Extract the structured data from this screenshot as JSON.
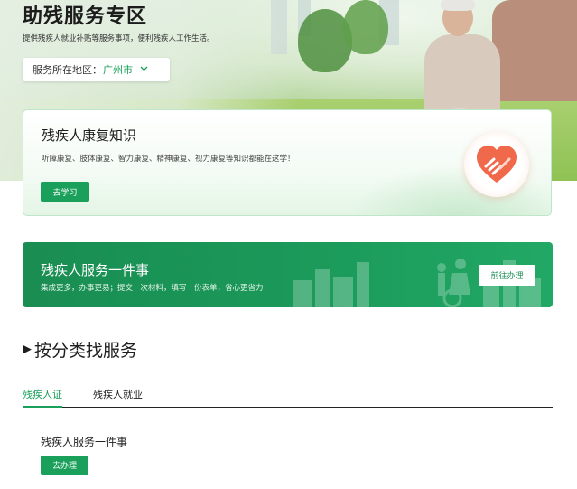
{
  "hero": {
    "title": "助残服务专区",
    "subtitle": "提供残疾人就业补贴等服务事项，便利残疾人工作生活。",
    "region_label": "服务所在地区：",
    "region_value": "广州市",
    "region_icon": "chevron-down-icon"
  },
  "knowledge_card": {
    "title": "残疾人康复知识",
    "description": "听障康复、肢体康复、智力康复、精神康复、视力康复等知识都能在这学！",
    "button_label": "去学习",
    "icon": "heart-hands-icon"
  },
  "one_thing_banner": {
    "title": "残疾人服务一件事",
    "description": "集成更多，办事更易；提交一次材料，填写一份表单，省心更省力",
    "button_label": "前往办理"
  },
  "category": {
    "title": "按分类找服务",
    "tabs": [
      {
        "label": "残疾人证",
        "active": true
      },
      {
        "label": "残疾人就业",
        "active": false
      }
    ],
    "items": [
      {
        "title": "残疾人服务一件事",
        "button_label": "去办理"
      }
    ]
  },
  "colors": {
    "accent": "#1aa05a",
    "banner_green": "#1b9a5a"
  }
}
